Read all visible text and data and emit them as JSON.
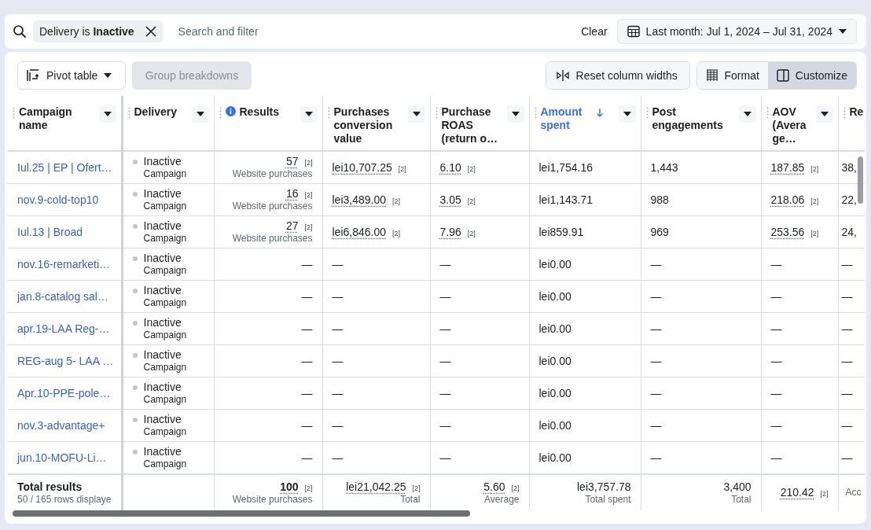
{
  "filter_bar": {
    "filter_chip": "Delivery is **Inactive**",
    "search": {
      "placeholder": "Search and filter"
    },
    "clear": "Clear",
    "date_range": "Last month: Jul 1, 2024 – Jul 31, 2024"
  },
  "toolbar": {
    "pivot": "Pivot table",
    "group_breakdowns": {
      "label": "Group breakdowns",
      "disabled": true
    },
    "reset_widths": "Reset column widths",
    "view_buttons": [
      {
        "label": "Format",
        "selected": false
      },
      {
        "label": "Customize",
        "selected": true
      }
    ]
  },
  "table": {
    "columns": [
      {
        "label": "Campaign name",
        "kind": "link",
        "info": false,
        "sorted": false
      },
      {
        "label": "Delivery",
        "kind": "status",
        "info": false,
        "sorted": false
      },
      {
        "label": "Results",
        "kind": "metric",
        "info": true,
        "sorted": false
      },
      {
        "label": "Purchases conversion value",
        "kind": "metric",
        "info": false,
        "sorted": false
      },
      {
        "label": "Purchase ROAS (return o…",
        "kind": "metric",
        "info": false,
        "sorted": false
      },
      {
        "label": "Amount spent",
        "kind": "metric",
        "info": false,
        "sorted": true
      },
      {
        "label": "Post engagements",
        "kind": "metric",
        "info": false,
        "sorted": false
      },
      {
        "label": "AOV (Avera ge…",
        "kind": "metric",
        "info": false,
        "sorted": false
      },
      {
        "label": "Re",
        "kind": "metric",
        "info": false,
        "sorted": false
      }
    ],
    "rows": [
      {
        "cells": [
          {
            "value": "Iul.25 | EP | Ofert…"
          },
          {
            "value": "Inactive",
            "sub": "Campaign"
          },
          {
            "value": "57",
            "note": "[2]",
            "sub": "Website purchases"
          },
          {
            "value": "lei10,707.25",
            "note": "[2]"
          },
          {
            "value": "6.10",
            "note": "[2]"
          },
          {
            "value": "lei1,754.16"
          },
          {
            "value": "1,443"
          },
          {
            "value": "187.85",
            "note": "[2]"
          },
          {
            "value": "38,"
          }
        ]
      },
      {
        "cells": [
          {
            "value": "nov.9-cold-top10"
          },
          {
            "value": "Inactive",
            "sub": "Campaign"
          },
          {
            "value": "16",
            "note": "[2]",
            "sub": "Website purchases"
          },
          {
            "value": "lei3,489.00",
            "note": "[2]"
          },
          {
            "value": "3.05",
            "note": "[2]"
          },
          {
            "value": "lei1,143.71"
          },
          {
            "value": "988"
          },
          {
            "value": "218.06",
            "note": "[2]"
          },
          {
            "value": "22,"
          }
        ]
      },
      {
        "cells": [
          {
            "value": "Iul.13 | Broad"
          },
          {
            "value": "Inactive",
            "sub": "Campaign"
          },
          {
            "value": "27",
            "note": "[2]",
            "sub": "Website purchases"
          },
          {
            "value": "lei6,846.00",
            "note": "[2]"
          },
          {
            "value": "7.96",
            "note": "[2]"
          },
          {
            "value": "lei859.91"
          },
          {
            "value": "969"
          },
          {
            "value": "253.56",
            "note": "[2]"
          },
          {
            "value": "24,"
          }
        ]
      },
      {
        "cells": [
          {
            "value": "nov.16-remarketi…"
          },
          {
            "value": "Inactive",
            "sub": "Campaign"
          },
          {
            "value": "—"
          },
          {
            "value": "—"
          },
          {
            "value": "—"
          },
          {
            "value": "lei0.00"
          },
          {
            "value": "—"
          },
          {
            "value": "—"
          },
          {
            "value": "—"
          }
        ]
      },
      {
        "cells": [
          {
            "value": "jan.8-catalog sal…"
          },
          {
            "value": "Inactive",
            "sub": "Campaign"
          },
          {
            "value": "—"
          },
          {
            "value": "—"
          },
          {
            "value": "—"
          },
          {
            "value": "lei0.00"
          },
          {
            "value": "—"
          },
          {
            "value": "—"
          },
          {
            "value": "—"
          }
        ]
      },
      {
        "cells": [
          {
            "value": "apr.19-LAA Reg-…"
          },
          {
            "value": "Inactive",
            "sub": "Campaign"
          },
          {
            "value": "—"
          },
          {
            "value": "—"
          },
          {
            "value": "—"
          },
          {
            "value": "lei0.00"
          },
          {
            "value": "—"
          },
          {
            "value": "—"
          },
          {
            "value": "—"
          }
        ]
      },
      {
        "cells": [
          {
            "value": "REG-aug 5- LAA …"
          },
          {
            "value": "Inactive",
            "sub": "Campaign"
          },
          {
            "value": "—"
          },
          {
            "value": "—"
          },
          {
            "value": "—"
          },
          {
            "value": "lei0.00"
          },
          {
            "value": "—"
          },
          {
            "value": "—"
          },
          {
            "value": "—"
          }
        ]
      },
      {
        "cells": [
          {
            "value": "Apr.10-PPE-pole…"
          },
          {
            "value": "Inactive",
            "sub": "Campaign"
          },
          {
            "value": "—"
          },
          {
            "value": "—"
          },
          {
            "value": "—"
          },
          {
            "value": "lei0.00"
          },
          {
            "value": "—"
          },
          {
            "value": "—"
          },
          {
            "value": "—"
          }
        ]
      },
      {
        "cells": [
          {
            "value": "nov.3-advantage+"
          },
          {
            "value": "Inactive",
            "sub": "Campaign"
          },
          {
            "value": "—"
          },
          {
            "value": "—"
          },
          {
            "value": "—"
          },
          {
            "value": "lei0.00"
          },
          {
            "value": "—"
          },
          {
            "value": "—"
          },
          {
            "value": "—"
          }
        ]
      },
      {
        "cells": [
          {
            "value": "jun.10-MOFU-Li…"
          },
          {
            "value": "Inactive",
            "sub": "Campaign"
          },
          {
            "value": "—"
          },
          {
            "value": "—"
          },
          {
            "value": "—"
          },
          {
            "value": "lei0.00"
          },
          {
            "value": "—"
          },
          {
            "value": "—"
          },
          {
            "value": "—"
          }
        ]
      }
    ],
    "footer": {
      "campaign_name": {
        "value": "Total results",
        "sub": "50 / 165 rows displaye"
      },
      "results": {
        "value": "100",
        "note": "[2]",
        "sub": "Website purchases"
      },
      "purchases_conversion_value": {
        "value": "lei21,042.25",
        "note": "[2]",
        "sub": "Total"
      },
      "purchase_roas": {
        "value": "5.60",
        "note": "[2]",
        "sub": "Average"
      },
      "amount_spent": {
        "value": "lei3,757.78",
        "sub": "Total spent"
      },
      "post_engagements": {
        "value": "3,400",
        "sub": "Total"
      },
      "aov": {
        "value": "210.42",
        "note": "[2]"
      },
      "column_9": {
        "sub": "Acc"
      }
    }
  }
}
